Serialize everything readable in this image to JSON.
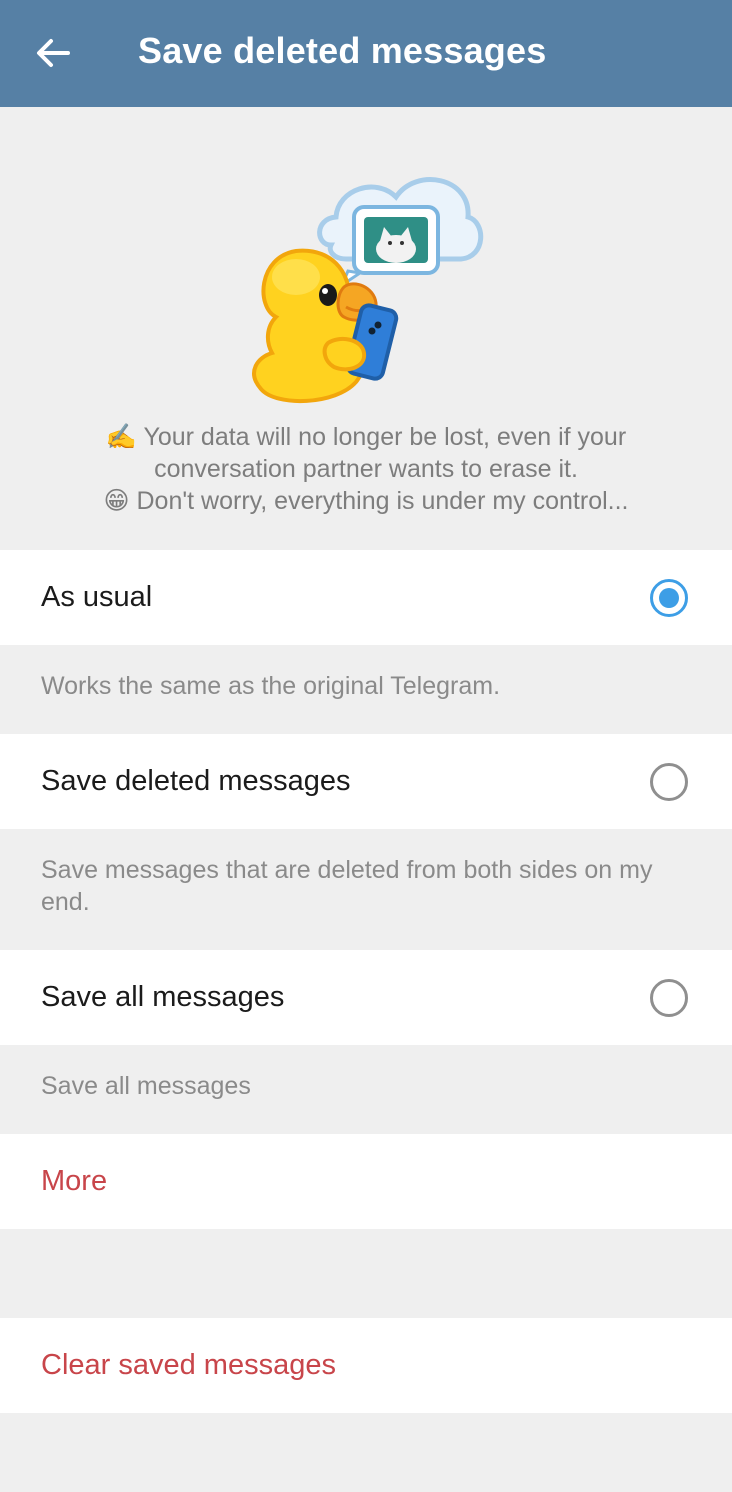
{
  "appbar": {
    "title": "Save deleted messages",
    "back_icon": "arrow-left-icon"
  },
  "hero": {
    "sticker": "duck-with-phone-sticker",
    "line1": "✍️ Your data will no longer be lost, even if your",
    "line2": "conversation partner wants to erase it.",
    "line3": "😁 Don't worry, everything is under my control..."
  },
  "options": [
    {
      "label": "As usual",
      "selected": true,
      "description": "Works the same as the original Telegram."
    },
    {
      "label": "Save deleted messages",
      "selected": false,
      "description": "Save messages that are deleted from both sides on my end."
    },
    {
      "label": "Save all messages",
      "selected": false,
      "description": "Save all messages"
    }
  ],
  "more_label": "More",
  "clear_label": "Clear saved messages",
  "colors": {
    "appbar": "#5680a5",
    "accent": "#3d9ee6",
    "destructive": "#c8454a"
  }
}
